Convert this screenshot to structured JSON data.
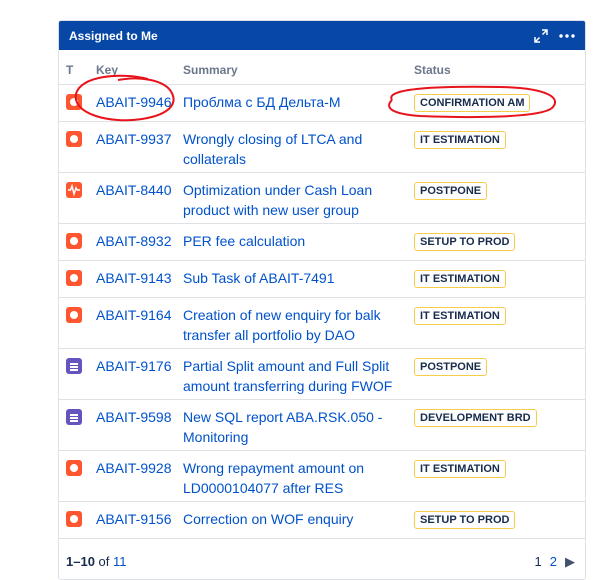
{
  "gadget": {
    "title": "Assigned to Me",
    "icons": [
      "expand-icon",
      "more-icon"
    ]
  },
  "table": {
    "columns": [
      "T",
      "Key",
      "Summary",
      "Status"
    ],
    "rows": [
      {
        "type": "bug",
        "key": "ABAIT-9946",
        "summary": "Проблма с БД Дельта-М",
        "status": "CONFIRMATION AM"
      },
      {
        "type": "bug",
        "key": "ABAIT-9937",
        "summary": "Wrongly closing of LTCA and collaterals",
        "status": "IT ESTIMATION"
      },
      {
        "type": "incident",
        "key": "ABAIT-8440",
        "summary": "Optimization under Cash Loan product with new user group",
        "status": "POSTPONE"
      },
      {
        "type": "bug",
        "key": "ABAIT-8932",
        "summary": "PER fee calculation",
        "status": "SETUP TO PROD"
      },
      {
        "type": "bug",
        "key": "ABAIT-9143",
        "summary": "Sub Task of ABAIT-7491",
        "status": "IT ESTIMATION"
      },
      {
        "type": "bug",
        "key": "ABAIT-9164",
        "summary": "Creation of new enquiry for balk transfer all portfolio by DAO",
        "status": "IT ESTIMATION"
      },
      {
        "type": "story",
        "key": "ABAIT-9176",
        "summary": "Partial Split amount and Full Split amount transferring during FWOF",
        "status": "POSTPONE"
      },
      {
        "type": "story",
        "key": "ABAIT-9598",
        "summary": "New SQL report ABA.RSK.050 - Monitoring",
        "status": "DEVELOPMENT BRD"
      },
      {
        "type": "bug",
        "key": "ABAIT-9928",
        "summary": "Wrong repayment amount on LD0000104077 after RES",
        "status": "IT ESTIMATION"
      },
      {
        "type": "bug",
        "key": "ABAIT-9156",
        "summary": "Correction on WOF enquiry",
        "status": "SETUP TO PROD"
      }
    ]
  },
  "footer": {
    "range": "1–10",
    "of_label": "of",
    "total": "11",
    "pages": [
      "1",
      "2"
    ]
  },
  "colors": {
    "header_bg": "#0747a6",
    "link": "#0052cc",
    "status_border": "#f5cd47",
    "bug": "#ff5630",
    "story": "#6554c0",
    "annotation_red": "#e8141c"
  }
}
